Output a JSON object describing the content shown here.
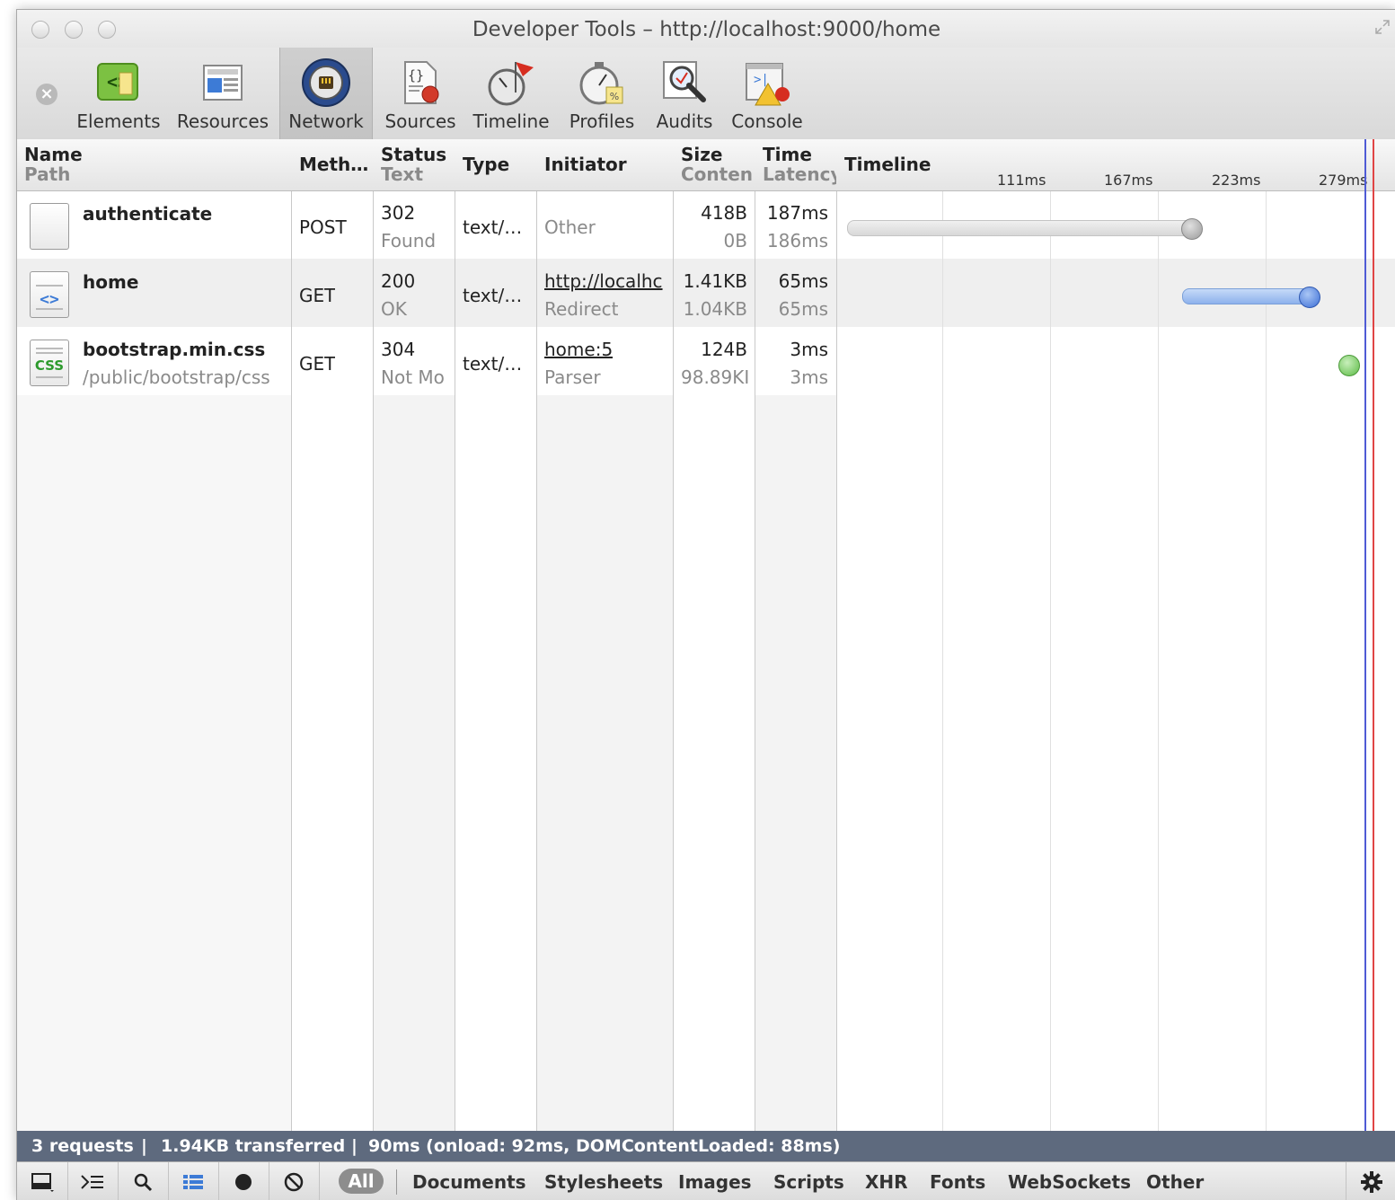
{
  "window": {
    "title": "Developer Tools – http://localhost:9000/home"
  },
  "toolbar": {
    "items": [
      {
        "label": "Elements",
        "icon": "elements-icon"
      },
      {
        "label": "Resources",
        "icon": "resources-icon"
      },
      {
        "label": "Network",
        "icon": "network-icon",
        "active": true
      },
      {
        "label": "Sources",
        "icon": "sources-icon"
      },
      {
        "label": "Timeline",
        "icon": "timeline-icon"
      },
      {
        "label": "Profiles",
        "icon": "profiles-icon"
      },
      {
        "label": "Audits",
        "icon": "audits-icon"
      },
      {
        "label": "Console",
        "icon": "console-icon"
      }
    ]
  },
  "table": {
    "headers": {
      "name": "Name",
      "path": "Path",
      "method": "Meth…",
      "status": "Status",
      "status_text": "Text",
      "type": "Type",
      "initiator": "Initiator",
      "size": "Size",
      "content": "Conten",
      "time": "Time",
      "latency": "Latency",
      "timeline": "Timeline"
    },
    "ticks": [
      "111ms",
      "167ms",
      "223ms",
      "279ms"
    ],
    "rows": [
      {
        "name": "authenticate",
        "path": "",
        "method": "POST",
        "status": "302",
        "status_text": "Found",
        "type": "text/…",
        "initiator": "Other",
        "initiator_sub": "",
        "size": "418B",
        "content": "0B",
        "time": "187ms",
        "latency": "186ms",
        "bar_color": "#cfcfcf"
      },
      {
        "name": "home",
        "path": "",
        "method": "GET",
        "status": "200",
        "status_text": "OK",
        "type": "text/…",
        "initiator": "http://localhc",
        "initiator_sub": "Redirect",
        "size": "1.41KB",
        "content": "1.04KB",
        "time": "65ms",
        "latency": "65ms",
        "bar_color": "#8db1ec"
      },
      {
        "name": "bootstrap.min.css",
        "path": "/public/bootstrap/css",
        "method": "GET",
        "status": "304",
        "status_text": "Not Mo",
        "type": "text/…",
        "initiator": "home:5",
        "initiator_sub": "Parser",
        "size": "124B",
        "content": "98.89KI",
        "time": "3ms",
        "latency": "3ms",
        "bar_color": "#8fd07c"
      }
    ]
  },
  "status": {
    "requests": "3 requests",
    "transferred": "1.94KB transferred",
    "timing": "90ms (onload: 92ms, DOMContentLoaded: 88ms)"
  },
  "filters": {
    "all": "All",
    "items": [
      "Documents",
      "Stylesheets",
      "Images",
      "Scripts",
      "XHR",
      "Fonts",
      "WebSockets",
      "Other"
    ]
  },
  "colors": {
    "statusbar": "#5e6a7e",
    "dom_line": "#4f5bd5",
    "load_line": "#e04545"
  }
}
